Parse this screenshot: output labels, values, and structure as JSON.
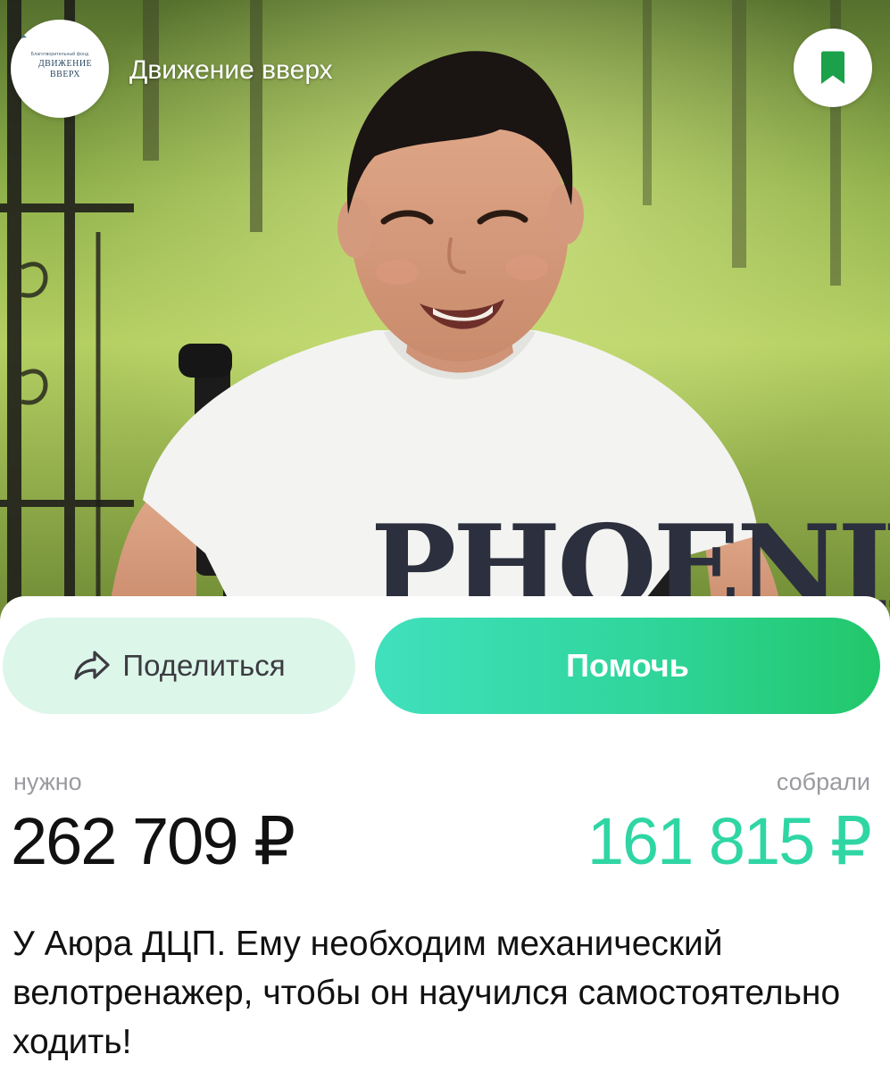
{
  "header": {
    "org_name": "Движение вверх",
    "logo": {
      "tiny_text": "Благотворительный фонд",
      "line1": "ДВИЖЕНИЕ",
      "line2": "ВВЕРХ"
    },
    "bookmark_icon": "bookmark-icon"
  },
  "actions": {
    "share_label": "Поделиться",
    "share_icon": "share-arrow-icon",
    "help_label": "Помочь"
  },
  "fundraising": {
    "need_label": "нужно",
    "need_amount": "262 709 ₽",
    "collected_label": "собрали",
    "collected_amount": "161 815 ₽"
  },
  "description": "У Аюра ДЦП. Ему необходим механический велотренажер, чтобы он научился самостоятельно ходить!",
  "colors": {
    "accent_green": "#2fd6a4",
    "button_gradient_start": "#40e0bd",
    "button_gradient_end": "#22c76a",
    "share_bg": "#dcf6ea",
    "bookmark_green": "#1aa14a"
  }
}
